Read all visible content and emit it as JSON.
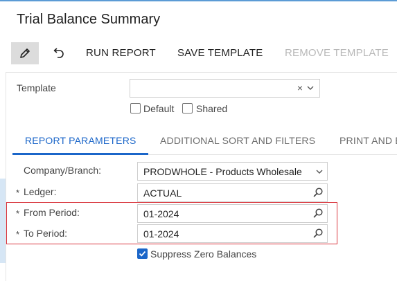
{
  "page": {
    "title": "Trial Balance Summary"
  },
  "toolbar": {
    "edit_icon": "pencil-icon",
    "undo_icon": "undo-icon",
    "run_report": "RUN REPORT",
    "save_template": "SAVE TEMPLATE",
    "remove_template": "REMOVE TEMPLATE"
  },
  "template": {
    "label": "Template",
    "value": "",
    "clear_glyph": "×",
    "default_label": "Default",
    "default_checked": false,
    "shared_label": "Shared",
    "shared_checked": false
  },
  "tabs": [
    {
      "label": "REPORT PARAMETERS",
      "active": true
    },
    {
      "label": "ADDITIONAL SORT AND FILTERS",
      "active": false
    },
    {
      "label": "PRINT AND E",
      "active": false
    }
  ],
  "params": {
    "company_branch": {
      "label": "Company/Branch:",
      "value": "PRODWHOLE - Products Wholesale",
      "required": false
    },
    "ledger": {
      "label": "Ledger:",
      "value": "ACTUAL",
      "required": true
    },
    "from_period": {
      "label": "From Period:",
      "value": "01-2024",
      "required": true
    },
    "to_period": {
      "label": "To Period:",
      "value": "01-2024",
      "required": true
    },
    "required_mark": "*",
    "suppress_zero": {
      "label": "Suppress Zero Balances",
      "checked": true
    }
  },
  "colors": {
    "accent": "#1b66c9",
    "highlight": "#d9363e",
    "disabled": "#b8b8b8"
  }
}
